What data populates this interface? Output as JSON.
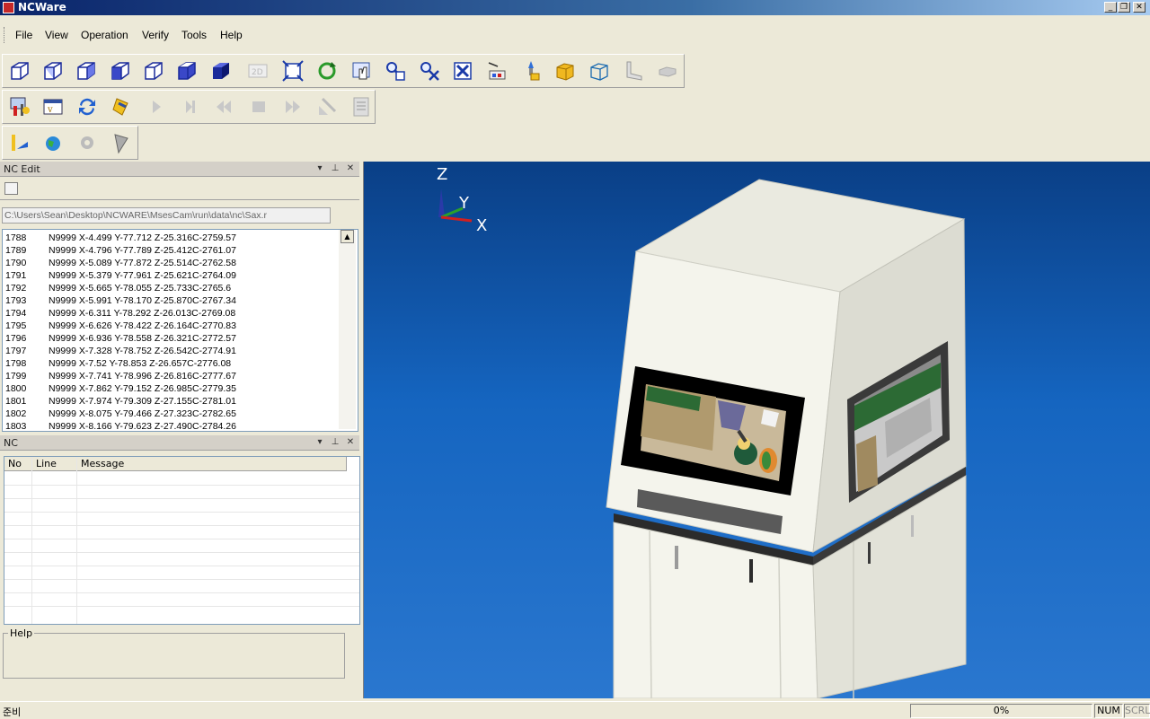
{
  "window": {
    "title": "NCWare",
    "controls": [
      "minimize",
      "restore",
      "close"
    ]
  },
  "menu": {
    "items": [
      "File",
      "View",
      "Operation",
      "Verify",
      "Tools",
      "Help"
    ]
  },
  "toolbar1": {
    "icons": [
      "iso-view-icon",
      "front-view-icon",
      "right-view-icon",
      "left-view-icon",
      "back-view-icon",
      "shaded-view-icon",
      "solid-view-icon",
      "2d-view-icon",
      "fit-view-icon",
      "rotate-view-icon",
      "pan-hand-icon",
      "zoom-icon",
      "zoom-fit-icon",
      "zoom-window-icon",
      "measure-icon",
      "tool-icon",
      "stock-box-icon",
      "wire-box-icon",
      "fixture-icon",
      "part-icon"
    ],
    "label_2d": "2D"
  },
  "toolbar2": {
    "icons": [
      "machine-setup-icon",
      "nc-program-icon",
      "refresh-icon",
      "simulate-icon",
      "play-icon",
      "step-icon",
      "rewind-icon",
      "stop-icon",
      "fast-forward-icon",
      "report-icon",
      "settings-list-icon"
    ]
  },
  "toolbar3": {
    "icons": [
      "pencil-tool-icon",
      "globe-icon",
      "gear-icon",
      "cut-tool-icon"
    ]
  },
  "nc_edit": {
    "title": "NC Edit",
    "path": "C:\\Users\\Sean\\Desktop\\NCWARE\\MsesCam\\run\\data\\nc\\Sax.r",
    "lines": [
      {
        "n": "1788",
        "code": "N9999 X-4.499 Y-77.712 Z-25.316C-2759.57"
      },
      {
        "n": "1789",
        "code": "N9999 X-4.796 Y-77.789 Z-25.412C-2761.07"
      },
      {
        "n": "1790",
        "code": "N9999 X-5.089 Y-77.872 Z-25.514C-2762.58"
      },
      {
        "n": "1791",
        "code": "N9999 X-5.379 Y-77.961 Z-25.621C-2764.09"
      },
      {
        "n": "1792",
        "code": "N9999 X-5.665 Y-78.055 Z-25.733C-2765.6"
      },
      {
        "n": "1793",
        "code": "N9999 X-5.991 Y-78.170 Z-25.870C-2767.34"
      },
      {
        "n": "1794",
        "code": "N9999 X-6.311 Y-78.292 Z-26.013C-2769.08"
      },
      {
        "n": "1795",
        "code": "N9999 X-6.626 Y-78.422 Z-26.164C-2770.83"
      },
      {
        "n": "1796",
        "code": "N9999 X-6.936 Y-78.558 Z-26.321C-2772.57"
      },
      {
        "n": "1797",
        "code": "N9999 X-7.328 Y-78.752 Z-26.542C-2774.91"
      },
      {
        "n": "1798",
        "code": "N9999 X-7.52 Y-78.853 Z-26.657C-2776.08"
      },
      {
        "n": "1799",
        "code": "N9999 X-7.741 Y-78.996 Z-26.816C-2777.67"
      },
      {
        "n": "1800",
        "code": "N9999 X-7.862 Y-79.152 Z-26.985C-2779.35"
      },
      {
        "n": "1801",
        "code": "N9999 X-7.974 Y-79.309 Z-27.155C-2781.01"
      },
      {
        "n": "1802",
        "code": "N9999 X-8.075 Y-79.466 Z-27.323C-2782.65"
      },
      {
        "n": "1803",
        "code": "N9999 X-8.166 Y-79.623 Z-27.490C-2784.26"
      }
    ]
  },
  "nc_panel": {
    "title": "NC",
    "columns": [
      "No",
      "Line",
      "Message"
    ],
    "rows": []
  },
  "help": {
    "label": "Help"
  },
  "viewport": {
    "axes": {
      "z": "Z",
      "y": "Y",
      "x": "X"
    },
    "background_top": "#0a3f86",
    "background_bottom": "#2a77cf"
  },
  "status": {
    "text": "준비",
    "progress": "0%",
    "progress_value": 0,
    "num": "NUM",
    "scrl": "SCRL"
  }
}
